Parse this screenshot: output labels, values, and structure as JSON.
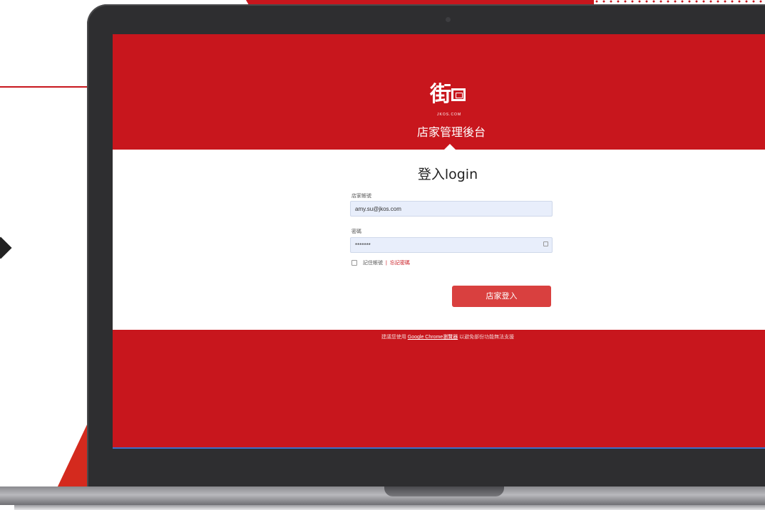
{
  "header": {
    "logo_mark": "街",
    "logo_sub": "JKOS.COM",
    "title": "店家管理後台"
  },
  "login": {
    "title": "登入login",
    "account_label": "店家帳號",
    "account_value": "amy.su@jkos.com",
    "password_label": "密碼",
    "password_value": "*******",
    "remember_label": "記住帳號",
    "forgot_label": "忘記密碼",
    "forgot_prefix": "|",
    "submit_label": "店家登入"
  },
  "footer": {
    "prefix": "建議您使用",
    "browser_link": "Google Chrome瀏覽器",
    "suffix": "以避免部份功能無法支援"
  },
  "colors": {
    "brand_red": "#c8161d",
    "button_red": "#d9403f",
    "input_bg": "#e8eefb",
    "bezel": "#2e2e30"
  },
  "icons": {
    "password_toggle": "key-icon",
    "logo": "jkos-logo-icon"
  }
}
